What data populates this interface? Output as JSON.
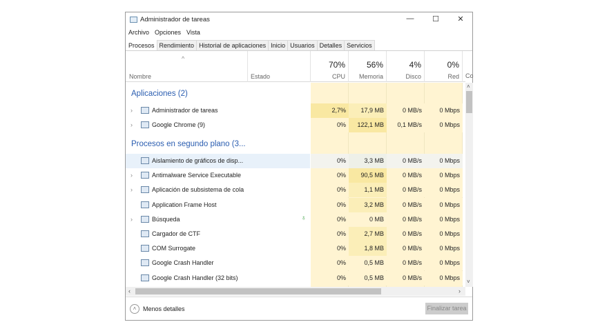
{
  "window": {
    "title": "Administrador de tareas",
    "minimize": "—",
    "maximize": "☐",
    "close": "✕"
  },
  "menu": [
    "Archivo",
    "Opciones",
    "Vista"
  ],
  "tabs": [
    "Procesos",
    "Rendimiento",
    "Historial de aplicaciones",
    "Inicio",
    "Usuarios",
    "Detalles",
    "Servicios"
  ],
  "columns": {
    "name": "Nombre",
    "status": "Estado",
    "cpu": {
      "pct": "70%",
      "label": "CPU"
    },
    "memory": {
      "pct": "56%",
      "label": "Memoria"
    },
    "disk": {
      "pct": "4%",
      "label": "Disco"
    },
    "network": {
      "pct": "0%",
      "label": "Red"
    },
    "next": "Co"
  },
  "groups": [
    {
      "label": "Aplicaciones (2)"
    },
    {
      "label": "Procesos en segundo plano (3..."
    }
  ],
  "apps": [
    {
      "name": "Administrador de tareas",
      "expand": true,
      "cpu": "2,7%",
      "mem": "17,9 MB",
      "disk": "0 MB/s",
      "net": "0 Mbps"
    },
    {
      "name": "Google Chrome (9)",
      "expand": true,
      "cpu": "0%",
      "mem": "122,1 MB",
      "disk": "0,1 MB/s",
      "net": "0 Mbps"
    }
  ],
  "background": [
    {
      "name": "Aislamiento de gráficos de disp...",
      "expand": false,
      "cpu": "0%",
      "mem": "3,3 MB",
      "disk": "0 MB/s",
      "net": "0 Mbps"
    },
    {
      "name": "Antimalware Service Executable",
      "expand": true,
      "cpu": "0%",
      "mem": "90,5 MB",
      "disk": "0 MB/s",
      "net": "0 Mbps"
    },
    {
      "name": "Aplicación de subsistema de cola",
      "expand": true,
      "cpu": "0%",
      "mem": "1,1 MB",
      "disk": "0 MB/s",
      "net": "0 Mbps"
    },
    {
      "name": "Application Frame Host",
      "expand": false,
      "cpu": "0%",
      "mem": "3,2 MB",
      "disk": "0 MB/s",
      "net": "0 Mbps"
    },
    {
      "name": "Búsqueda",
      "expand": true,
      "cpu": "0%",
      "mem": "0 MB",
      "disk": "0 MB/s",
      "net": "0 Mbps"
    },
    {
      "name": "Cargador de CTF",
      "expand": false,
      "cpu": "0%",
      "mem": "2,7 MB",
      "disk": "0 MB/s",
      "net": "0 Mbps"
    },
    {
      "name": "COM Surrogate",
      "expand": false,
      "cpu": "0%",
      "mem": "1,8 MB",
      "disk": "0 MB/s",
      "net": "0 Mbps"
    },
    {
      "name": "Google Crash Handler",
      "expand": false,
      "cpu": "0%",
      "mem": "0,5 MB",
      "disk": "0 MB/s",
      "net": "0 Mbps"
    },
    {
      "name": "Google Crash Handler (32 bits)",
      "expand": false,
      "cpu": "0%",
      "mem": "0,5 MB",
      "disk": "0 MB/s",
      "net": "0 Mbps"
    }
  ],
  "footer": {
    "fewer_details": "Menos detalles",
    "end_task": "Finalizar tarea"
  }
}
